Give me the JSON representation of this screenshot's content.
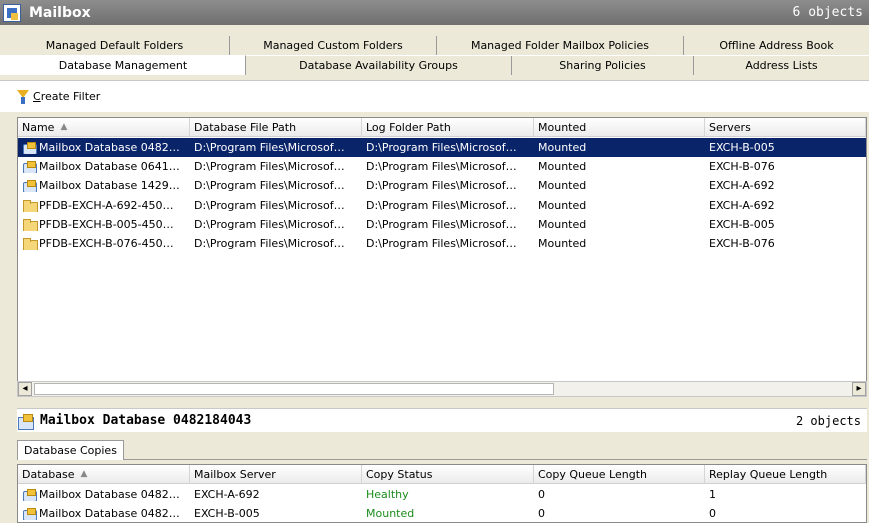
{
  "window": {
    "title": "Mailbox",
    "count": "6 objects"
  },
  "tabs": {
    "row1": [
      "Managed Default Folders",
      "Managed Custom Folders",
      "Managed Folder Mailbox Policies",
      "Offline Address Book"
    ],
    "row2": [
      "Database Management",
      "Database Availability Groups",
      "Sharing Policies",
      "Address Lists"
    ],
    "active": "Database Management"
  },
  "toolbar": {
    "create_filter_prefix": "C",
    "create_filter_rest": "reate Filter"
  },
  "main_grid": {
    "columns": [
      "Name",
      "Database File Path",
      "Log Folder Path",
      "Mounted",
      "Servers"
    ],
    "sort_indicator": "▲",
    "rows": [
      {
        "icon": "database-icon",
        "name": "Mailbox Database 0482…",
        "file_path": "D:\\Program Files\\Microsof…",
        "log_path": "D:\\Program Files\\Microsof…",
        "mounted": "Mounted",
        "servers": "EXCH-B-005",
        "selected": true
      },
      {
        "icon": "database-icon",
        "name": "Mailbox Database 0641…",
        "file_path": "D:\\Program Files\\Microsof…",
        "log_path": "D:\\Program Files\\Microsof…",
        "mounted": "Mounted",
        "servers": "EXCH-B-076",
        "selected": false
      },
      {
        "icon": "database-icon",
        "name": "Mailbox Database 1429…",
        "file_path": "D:\\Program Files\\Microsof…",
        "log_path": "D:\\Program Files\\Microsof…",
        "mounted": "Mounted",
        "servers": "EXCH-A-692",
        "selected": false
      },
      {
        "icon": "folder-icon",
        "name": "PFDB-EXCH-A-692-450…",
        "file_path": "D:\\Program Files\\Microsof…",
        "log_path": "D:\\Program Files\\Microsof…",
        "mounted": "Mounted",
        "servers": "EXCH-A-692",
        "selected": false
      },
      {
        "icon": "folder-icon",
        "name": "PFDB-EXCH-B-005-450…",
        "file_path": "D:\\Program Files\\Microsof…",
        "log_path": "D:\\Program Files\\Microsof…",
        "mounted": "Mounted",
        "servers": "EXCH-B-005",
        "selected": false
      },
      {
        "icon": "folder-icon",
        "name": "PFDB-EXCH-B-076-450…",
        "file_path": "D:\\Program Files\\Microsof…",
        "log_path": "D:\\Program Files\\Microsof…",
        "mounted": "Mounted",
        "servers": "EXCH-B-076",
        "selected": false
      }
    ]
  },
  "scrollbar": {
    "left_arrow": "◂",
    "right_arrow": "▸"
  },
  "detail": {
    "title": "Mailbox Database 0482184043",
    "count": "2 objects",
    "tab": "Database Copies"
  },
  "copies_grid": {
    "columns": [
      "Database",
      "Mailbox Server",
      "Copy Status",
      "Copy Queue Length",
      "Replay Queue Length"
    ],
    "sort_indicator": "▲",
    "rows": [
      {
        "database": "Mailbox Database 0482…",
        "server": "EXCH-A-692",
        "status": "Healthy",
        "copy_queue": "0",
        "replay_queue": "1"
      },
      {
        "database": "Mailbox Database 0482…",
        "server": "EXCH-B-005",
        "status": "Mounted",
        "copy_queue": "0",
        "replay_queue": "0"
      }
    ]
  },
  "colors": {
    "selection": "#0a246a",
    "status_ok": "#1c8c1c"
  }
}
